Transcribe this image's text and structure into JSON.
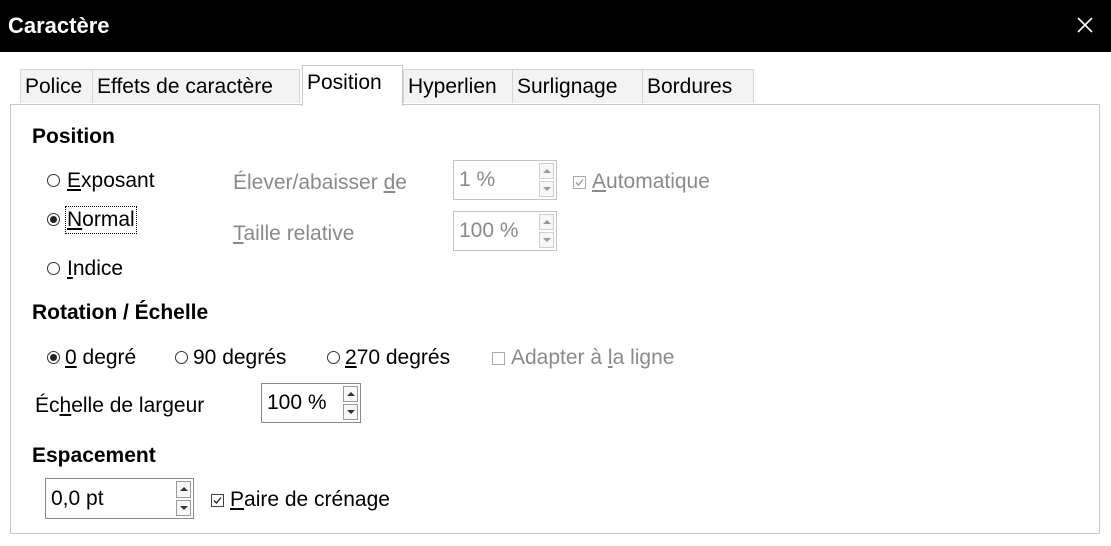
{
  "window": {
    "title": "Caractère"
  },
  "tabs": [
    "Police",
    "Effets de caractère",
    "Position",
    "Hyperlien",
    "Surlignage",
    "Bordures"
  ],
  "active_tab": "Position",
  "position": {
    "heading": "Position",
    "radios": [
      {
        "mn": "E",
        "rest": "xposant",
        "selected": false
      },
      {
        "mn": "N",
        "rest": "ormal",
        "selected": true
      },
      {
        "mn": "I",
        "rest": "ndice",
        "selected": false
      }
    ],
    "raise": {
      "pre": "Élever/abaisser ",
      "mn": "d",
      "post": "e",
      "value": "1 %"
    },
    "auto": {
      "mn": "A",
      "rest": "utomatique",
      "checked": true
    },
    "size": {
      "mn": "T",
      "rest": "aille relative",
      "value": "100 %"
    }
  },
  "rotation": {
    "heading": "Rotation / Échelle",
    "radios": [
      {
        "mn": "0",
        "rest": " degré",
        "selected": true
      },
      {
        "mn": "",
        "rest": "90 degrés",
        "selected": false
      },
      {
        "mn": "2",
        "rest": "70 degrés",
        "selected": false
      }
    ],
    "fit": {
      "pre": "Adapter à ",
      "mn": "l",
      "post": "a ligne",
      "checked": false
    },
    "scale": {
      "pre": "Éc",
      "mn": "h",
      "post": "elle de largeur",
      "value": "100 %"
    }
  },
  "spacing": {
    "heading": "Espacement",
    "value": "0,0 pt",
    "kerning": {
      "mn": "P",
      "rest": "aire de crénage",
      "checked": true
    }
  }
}
